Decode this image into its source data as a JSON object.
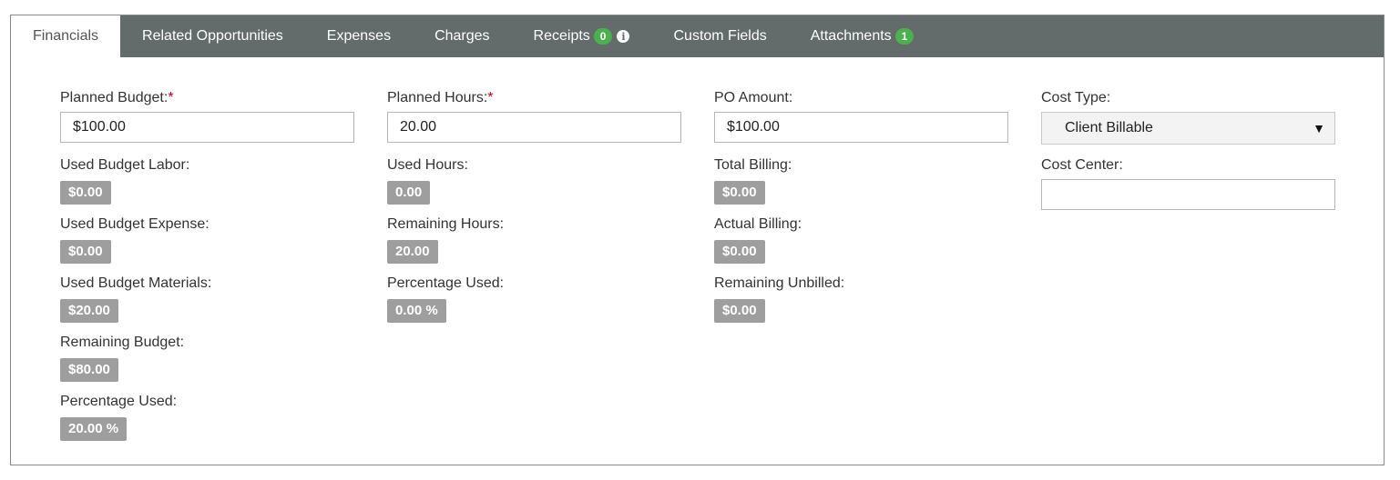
{
  "tabs": [
    {
      "label": "Financials",
      "active": true
    },
    {
      "label": "Related Opportunities"
    },
    {
      "label": "Expenses"
    },
    {
      "label": "Charges"
    },
    {
      "label": "Receipts",
      "badge": "0",
      "info": true
    },
    {
      "label": "Custom Fields"
    },
    {
      "label": "Attachments",
      "badge": "1"
    }
  ],
  "col1": {
    "planned_budget_label": "Planned Budget:",
    "planned_budget_value": "$100.00",
    "used_labor_label": "Used Budget Labor:",
    "used_labor_value": "$0.00",
    "used_expense_label": "Used Budget Expense:",
    "used_expense_value": "$0.00",
    "used_materials_label": "Used Budget Materials:",
    "used_materials_value": "$20.00",
    "remaining_budget_label": "Remaining Budget:",
    "remaining_budget_value": "$80.00",
    "percentage_used_label": "Percentage Used:",
    "percentage_used_value": "20.00 %"
  },
  "col2": {
    "planned_hours_label": "Planned Hours:",
    "planned_hours_value": "20.00",
    "used_hours_label": "Used Hours:",
    "used_hours_value": "0.00",
    "remaining_hours_label": "Remaining Hours:",
    "remaining_hours_value": "20.00",
    "percentage_used_label": "Percentage Used:",
    "percentage_used_value": "0.00 %"
  },
  "col3": {
    "po_amount_label": "PO Amount:",
    "po_amount_value": "$100.00",
    "total_billing_label": "Total Billing:",
    "total_billing_value": "$0.00",
    "actual_billing_label": "Actual Billing:",
    "actual_billing_value": "$0.00",
    "remaining_unbilled_label": "Remaining Unbilled:",
    "remaining_unbilled_value": "$0.00"
  },
  "col4": {
    "cost_type_label": "Cost Type:",
    "cost_type_value": "Client Billable",
    "cost_center_label": "Cost Center:",
    "cost_center_value": ""
  },
  "required_mark": "*",
  "colors": {
    "tabbar": "#636b6b",
    "badge": "#4caf50",
    "pill": "#9e9e9e",
    "required": "#d0021b"
  }
}
